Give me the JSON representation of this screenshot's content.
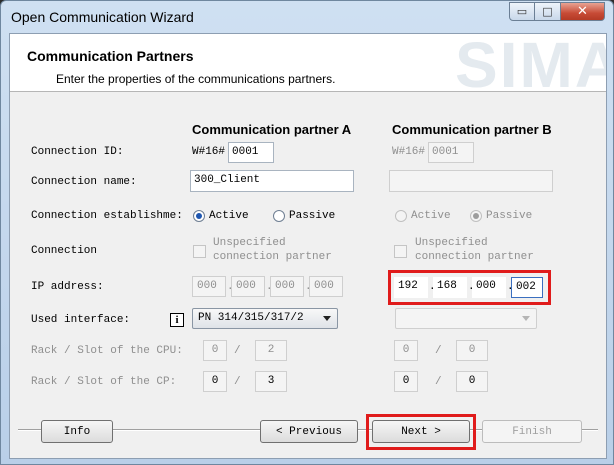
{
  "window": {
    "title": "Open Communication Wizard",
    "buttons": {
      "minimize": "▭",
      "maximize": "□",
      "close": "✕"
    }
  },
  "header": {
    "title": "Communication Partners",
    "subtitle": "Enter the properties of the communications partners.",
    "watermark": "SIMA"
  },
  "columns": {
    "a": "Communication partner A",
    "b": "Communication partner B"
  },
  "labels": {
    "connection_id": "Connection ID:",
    "connection_name": "Connection name:",
    "connection_establishment": "Connection establishme:",
    "connection": "Connection",
    "ip_address": "IP address:",
    "used_interface": "Used interface:",
    "rack_slot_cpu": "Rack / Slot of the  CPU:",
    "rack_slot_cp": "Rack / Slot of the CP:"
  },
  "partner_a": {
    "id_prefix": "W#16#",
    "id_value": "0001",
    "name_value": "300_Client",
    "active_label": "Active",
    "passive_label": "Passive",
    "unspecified_line1": "Unspecified",
    "unspecified_line2": "connection partner",
    "ip": [
      "000",
      "000",
      "000",
      "000"
    ],
    "interface": "PN 314/315/317/2",
    "cpu_rack": "0",
    "cpu_slot": "2",
    "cp_rack": "0",
    "cp_slot": "3",
    "slash": "/"
  },
  "partner_b": {
    "id_prefix": "W#16#",
    "id_value": "0001",
    "name_value": "",
    "active_label": "Active",
    "passive_label": "Passive",
    "unspecified_line1": "Unspecified",
    "unspecified_line2": "connection partner",
    "ip": [
      "192",
      "168",
      "000",
      "002"
    ],
    "interface": "",
    "cpu_rack": "0",
    "cpu_slot": "0",
    "cp_rack": "0",
    "cp_slot": "0",
    "slash": "/"
  },
  "info_icon": "i",
  "ip_dot": ".",
  "footer": {
    "info": "Info",
    "previous": "< Previous",
    "next": "Next >",
    "finish": "Finish"
  }
}
